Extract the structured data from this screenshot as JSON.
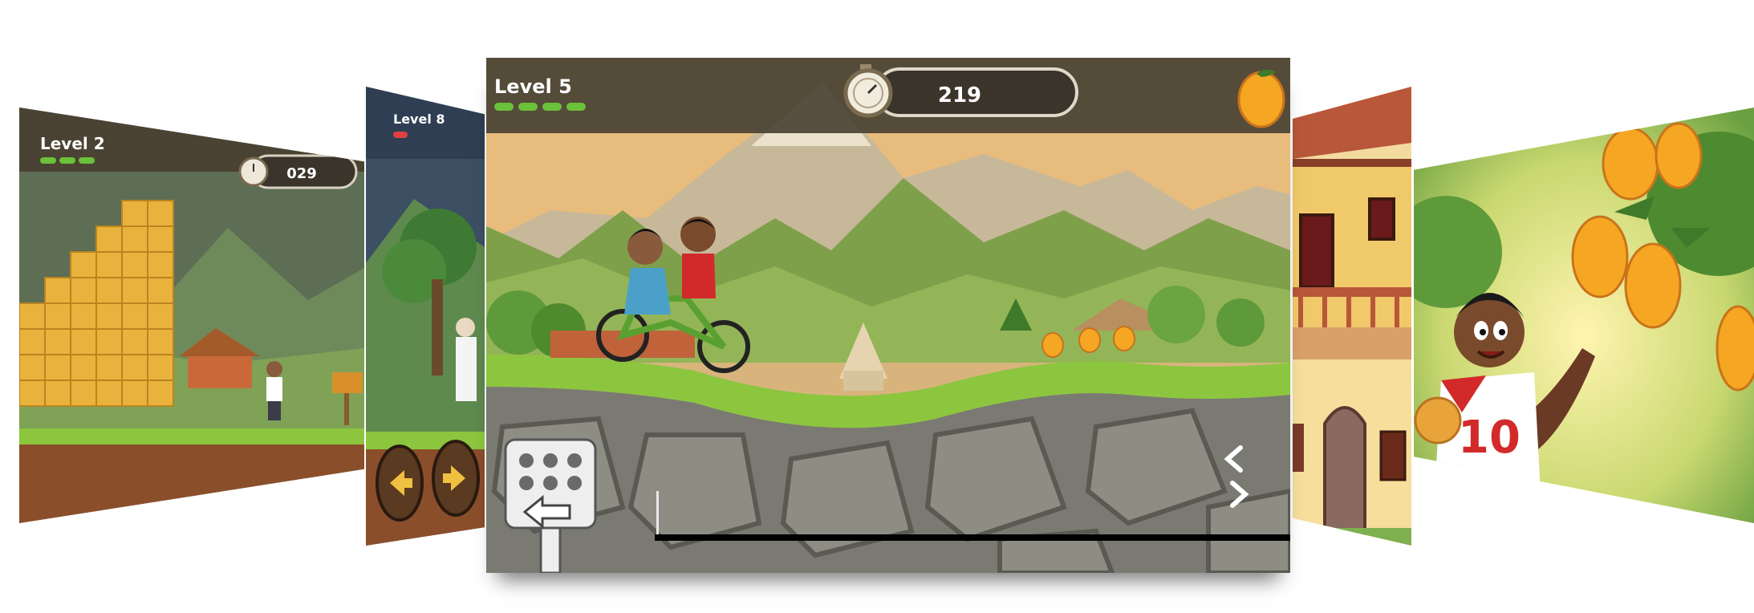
{
  "screens": {
    "left_far": {
      "level_label": "Level 2",
      "timer": "029"
    },
    "left_near": {
      "level_label": "Level 8"
    },
    "center": {
      "level_label": "Level 5",
      "timer": "219",
      "progress": 0.0
    },
    "right_far": {
      "jersey_number": "10"
    }
  },
  "icons": {
    "timer": "stopwatch-icon",
    "collectible": "mango-icon",
    "left": "arrow-left-icon",
    "right": "arrow-right-icon",
    "brake": "brake-pedal-icon",
    "accelerate": "accelerate-icon"
  },
  "colors": {
    "hud_bar": "#4a4233",
    "health": "#6cc13a",
    "grass": "#8cc63f",
    "rock": "#7a7a72",
    "mango": "#f5a623",
    "sky": "#e9b878"
  }
}
